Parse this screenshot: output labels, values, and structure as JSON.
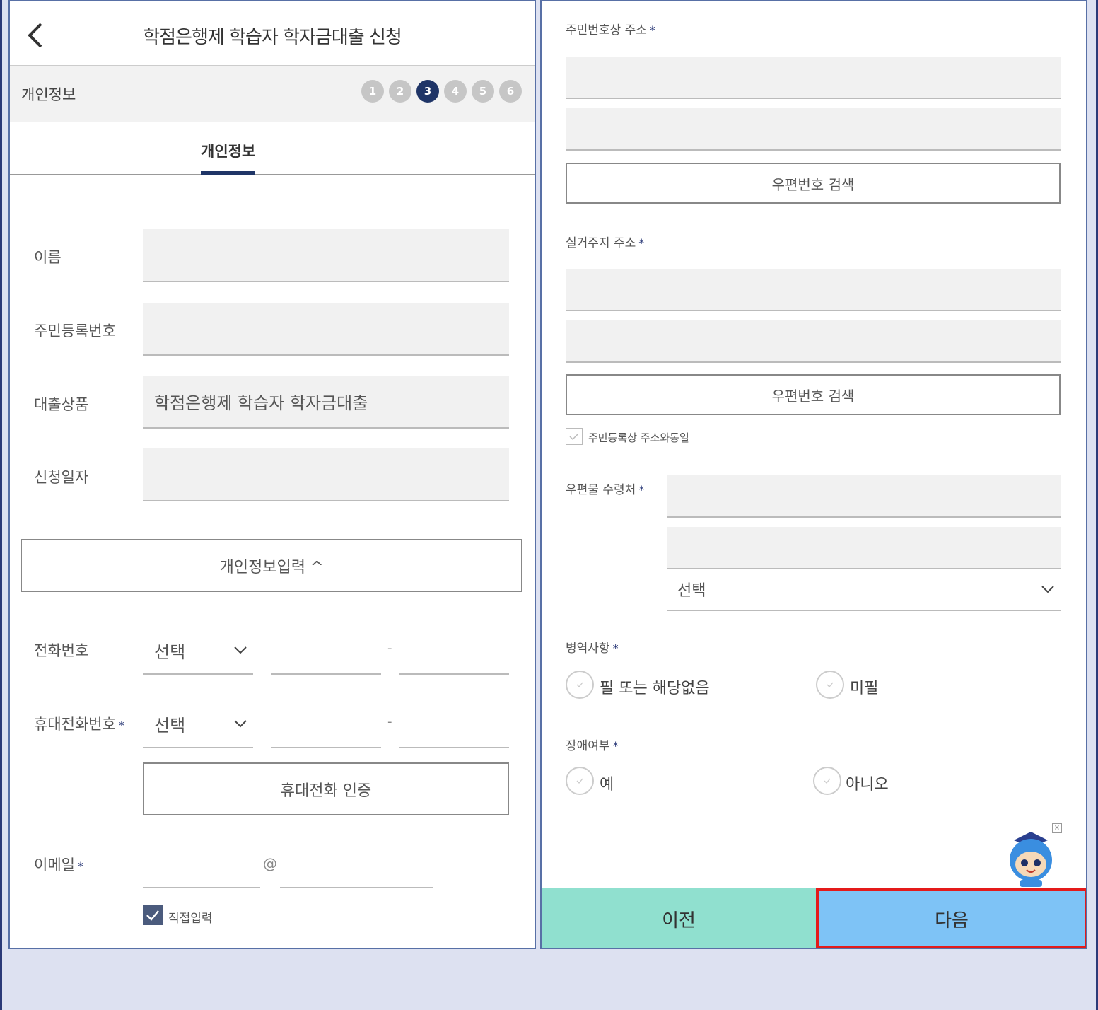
{
  "header": {
    "title": "학점은행제 학습자 학자금대출 신청"
  },
  "step_bar": {
    "label": "개인정보",
    "steps": [
      "1",
      "2",
      "3",
      "4",
      "5",
      "6"
    ],
    "active_step": "3"
  },
  "tab": {
    "label": "개인정보"
  },
  "left_form": {
    "name_label": "이름",
    "rrn_label": "주민등록번호",
    "loan_product_label": "대출상품",
    "loan_product_value": "학점은행제 학습자 학자금대출",
    "apply_date_label": "신청일자",
    "personal_info_button": "개인정보입력 ^",
    "phone_label": "전화번호",
    "phone_select": "선택",
    "mobile_label": "휴대전화번호",
    "mobile_select": "선택",
    "dash": "-",
    "mobile_auth_button": "휴대전화 인증",
    "email_label": "이메일",
    "email_at": "@",
    "direct_input_label": "직접입력",
    "required_mark": "*"
  },
  "right_form": {
    "resident_address_label": "주민번호상 주소",
    "zip_search_button_1": "우편번호 검색",
    "actual_address_label": "실거주지 주소",
    "zip_search_button_2": "우편번호 검색",
    "same_address_label": "주민등록상 주소와동일",
    "mail_recipient_label": "우편물 수령처",
    "mail_select": "선택",
    "military_label": "병역사항",
    "military_option_1": "필 또는 해당없음",
    "military_option_2": "미필",
    "disability_label": "장애여부",
    "disability_option_1": "예",
    "disability_option_2": "아니오",
    "required_mark": "*"
  },
  "footer": {
    "prev_label": "이전",
    "next_label": "다음"
  },
  "colors": {
    "accent": "#1f3567",
    "prev_bg": "#90e0cf",
    "next_bg": "#7ec3f6",
    "highlight": "#e41a1a"
  }
}
